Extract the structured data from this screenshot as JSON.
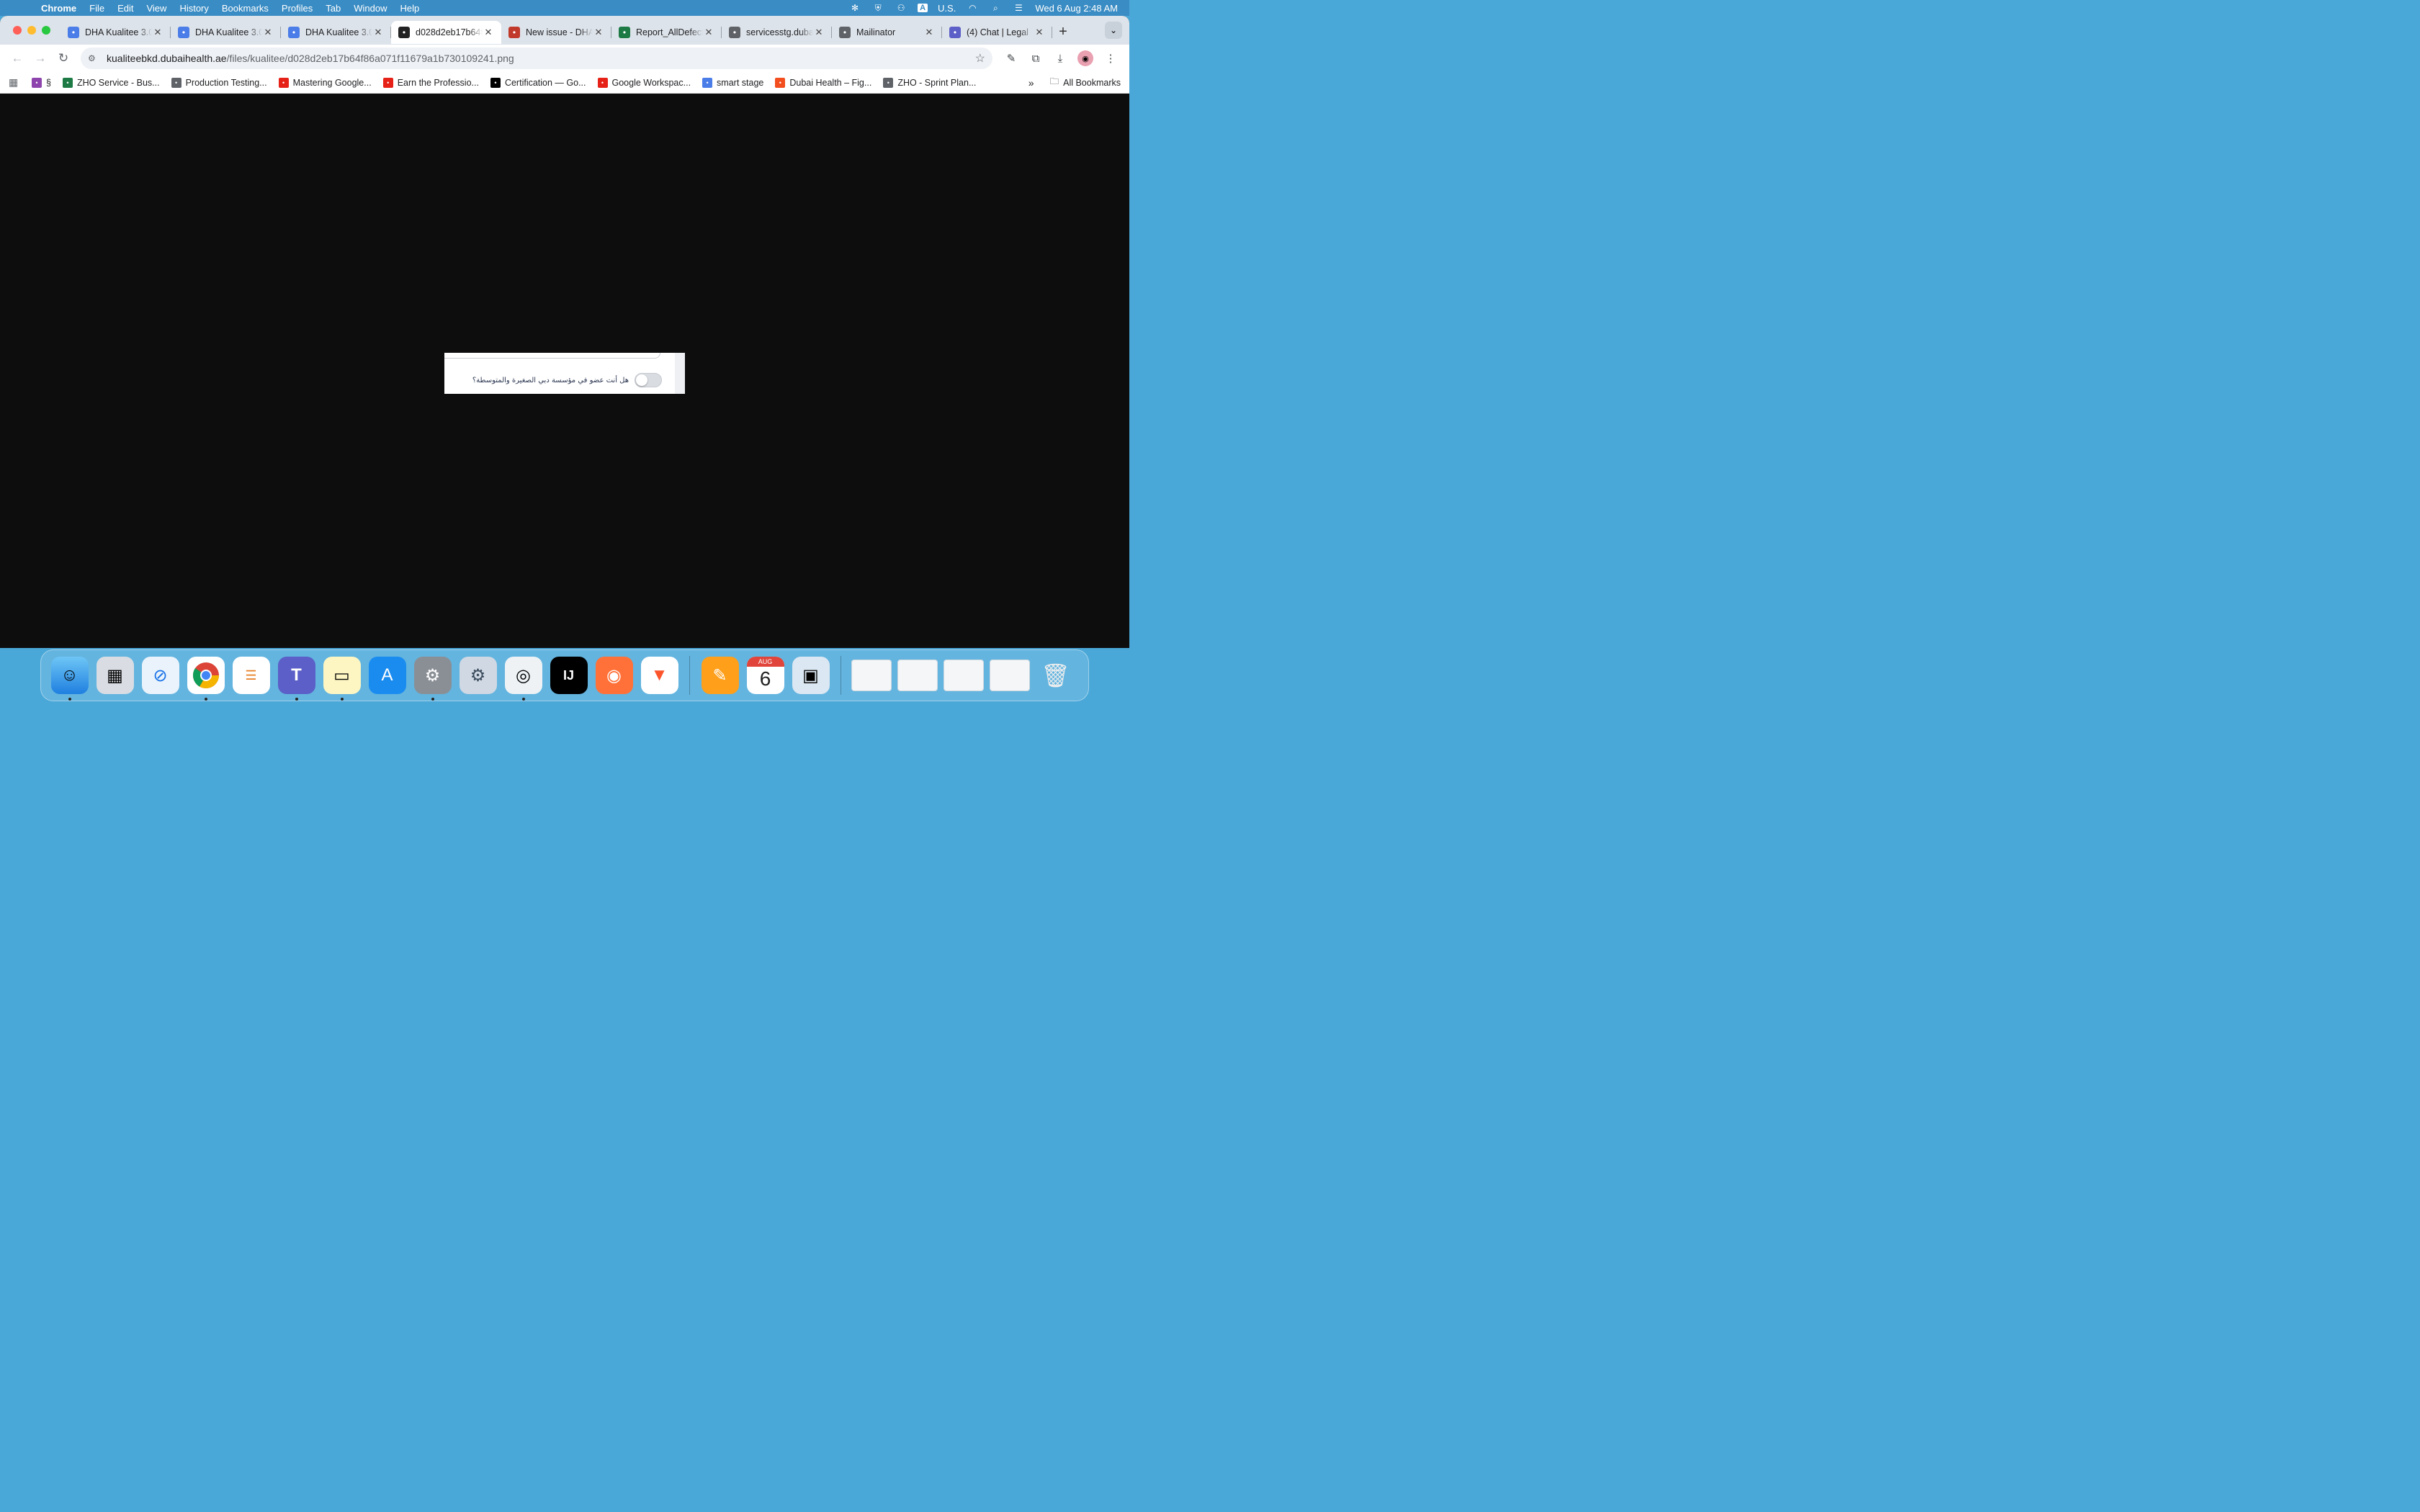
{
  "menubar": {
    "app_name": "Chrome",
    "menus": [
      "File",
      "Edit",
      "View",
      "History",
      "Bookmarks",
      "Profiles",
      "Tab",
      "Window",
      "Help"
    ],
    "input_source": "U.S.",
    "lang_badge": "A",
    "datetime": "Wed 6 Aug  2:48 AM"
  },
  "tabs": [
    {
      "title": "DHA Kualitee 3.0",
      "icon": "kualitee-icon",
      "color": "#4a7de8"
    },
    {
      "title": "DHA Kualitee 3.0",
      "icon": "kualitee-icon",
      "color": "#4a7de8"
    },
    {
      "title": "DHA Kualitee 3.0",
      "icon": "kualitee-icon",
      "color": "#4a7de8"
    },
    {
      "title": "d028d2eb17b64f86a071f11679a1b730109241.png",
      "icon": "image-file-icon",
      "color": "#222222",
      "active": true
    },
    {
      "title": "New issue - DHA",
      "icon": "issue-tracker-icon",
      "color": "#c0392b"
    },
    {
      "title": "Report_AllDefects",
      "icon": "excel-icon",
      "color": "#1d7a45"
    },
    {
      "title": "servicesstg.dubaihealth",
      "icon": "globe-icon",
      "color": "#5f6368"
    },
    {
      "title": "Mailinator",
      "icon": "globe-icon",
      "color": "#5f6368"
    },
    {
      "title": "(4) Chat | Legal",
      "icon": "teams-icon",
      "color": "#5b5fc7"
    }
  ],
  "toolbar": {
    "url_domain": "kualiteebkd.dubaihealth.ae",
    "url_path": "/files/kualitee/d028d2eb17b64f86a071f11679a1b730109241.png"
  },
  "bookmarks": [
    {
      "label": "§",
      "icon": "flower-icon",
      "color": "#8e44ad"
    },
    {
      "label": "ZHO Service - Bus...",
      "icon": "excel-icon",
      "color": "#1d7a45"
    },
    {
      "label": "Production Testing...",
      "icon": "globe-icon",
      "color": "#5f6368"
    },
    {
      "label": "Mastering Google...",
      "icon": "youtube-icon",
      "color": "#e62117"
    },
    {
      "label": "Earn the Professio...",
      "icon": "youtube-icon",
      "color": "#e62117"
    },
    {
      "label": "Certification — Go...",
      "icon": "medium-icon",
      "color": "#000000"
    },
    {
      "label": "Google Workspac...",
      "icon": "youtube-icon",
      "color": "#e62117"
    },
    {
      "label": "smart stage",
      "icon": "chart-icon",
      "color": "#4a7de8"
    },
    {
      "label": "Dubai Health – Fig...",
      "icon": "figma-icon",
      "color": "#f24e1e"
    },
    {
      "label": "ZHO - Sprint Plan...",
      "icon": "globe-icon",
      "color": "#5f6368"
    }
  ],
  "all_bookmarks_label": "All Bookmarks",
  "image": {
    "toggle_label": "هل أنت عضو في مؤسسة دبي الصغيرة والمتوسطة؟",
    "toggle_on": false
  },
  "dock": {
    "apps": [
      "Finder",
      "Launchpad",
      "Safari",
      "Chrome",
      "Reminders",
      "Teams",
      "Notes",
      "App Store",
      "System Settings",
      "Settings Utility",
      "Proxy",
      "IntelliJ IDEA",
      "Firefox",
      "Brave",
      "Pages",
      "Calendar",
      "Preview"
    ],
    "calendar_month": "AUG",
    "calendar_day": "6"
  }
}
